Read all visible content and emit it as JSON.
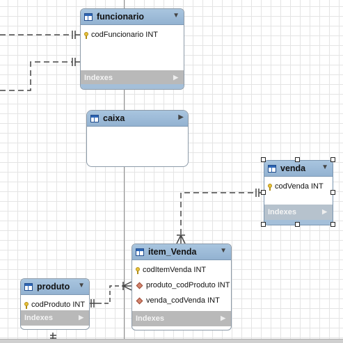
{
  "tables": {
    "funcionario": {
      "name": "funcionario",
      "columns": [
        {
          "label": "codFuncionario INT",
          "icon": "primary-key-icon"
        }
      ],
      "indexes_label": "Indexes"
    },
    "caixa": {
      "name": "caixa",
      "columns": []
    },
    "venda": {
      "name": "venda",
      "columns": [
        {
          "label": "codVenda INT",
          "icon": "primary-key-icon"
        }
      ],
      "indexes_label": "Indexes",
      "selected": true
    },
    "item_venda": {
      "name": "item_Venda",
      "columns": [
        {
          "label": "codItemVenda INT",
          "icon": "primary-key-icon"
        },
        {
          "label": "produto_codProduto INT",
          "icon": "foreign-key-icon"
        },
        {
          "label": "venda_codVenda INT",
          "icon": "foreign-key-icon"
        }
      ],
      "indexes_label": "Indexes"
    },
    "produto": {
      "name": "produto",
      "columns": [
        {
          "label": "codProduto INT",
          "icon": "primary-key-icon"
        }
      ],
      "indexes_label": "Indexes"
    }
  },
  "colors": {
    "header": "#9ebbd8",
    "indexes_bar": "#b9b9b9",
    "connector": "#444444",
    "primary_key": "#e9c23a",
    "foreign_key": "#d4846e"
  },
  "relationships": [
    {
      "from": "funcionario",
      "to": "off-canvas-left",
      "cardinality": "one-to-one"
    },
    {
      "from": "funcionario",
      "to": "off-canvas-left",
      "cardinality": "one-to-one"
    },
    {
      "from": "item_Venda",
      "to": "venda",
      "cardinality": "many-to-one"
    },
    {
      "from": "item_Venda",
      "to": "produto",
      "cardinality": "many-to-one"
    }
  ]
}
